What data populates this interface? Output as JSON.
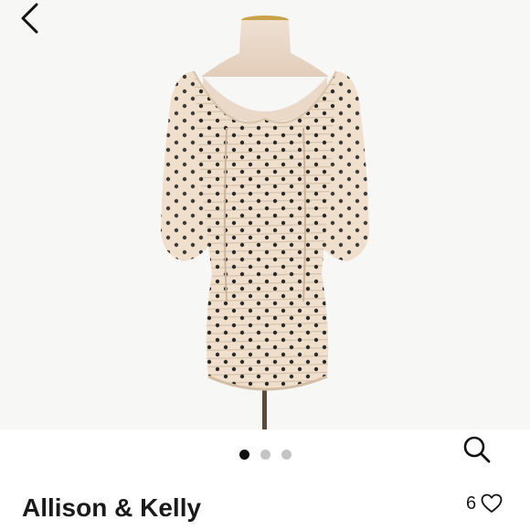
{
  "listing": {
    "brand": "Allison & Kelly",
    "like_count": "6",
    "photo": {
      "subject": "dress-on-mannequin",
      "colors": {
        "fabric": "#efdfcc",
        "dots": "#2a2a2a",
        "mannequin": "#e8d5c4",
        "background": "#f7f7f5"
      }
    },
    "carousel": {
      "total": 3,
      "active": 0
    }
  },
  "icons": {
    "back": "chevron-left-icon",
    "zoom": "search-icon",
    "like": "heart-outline-icon"
  }
}
